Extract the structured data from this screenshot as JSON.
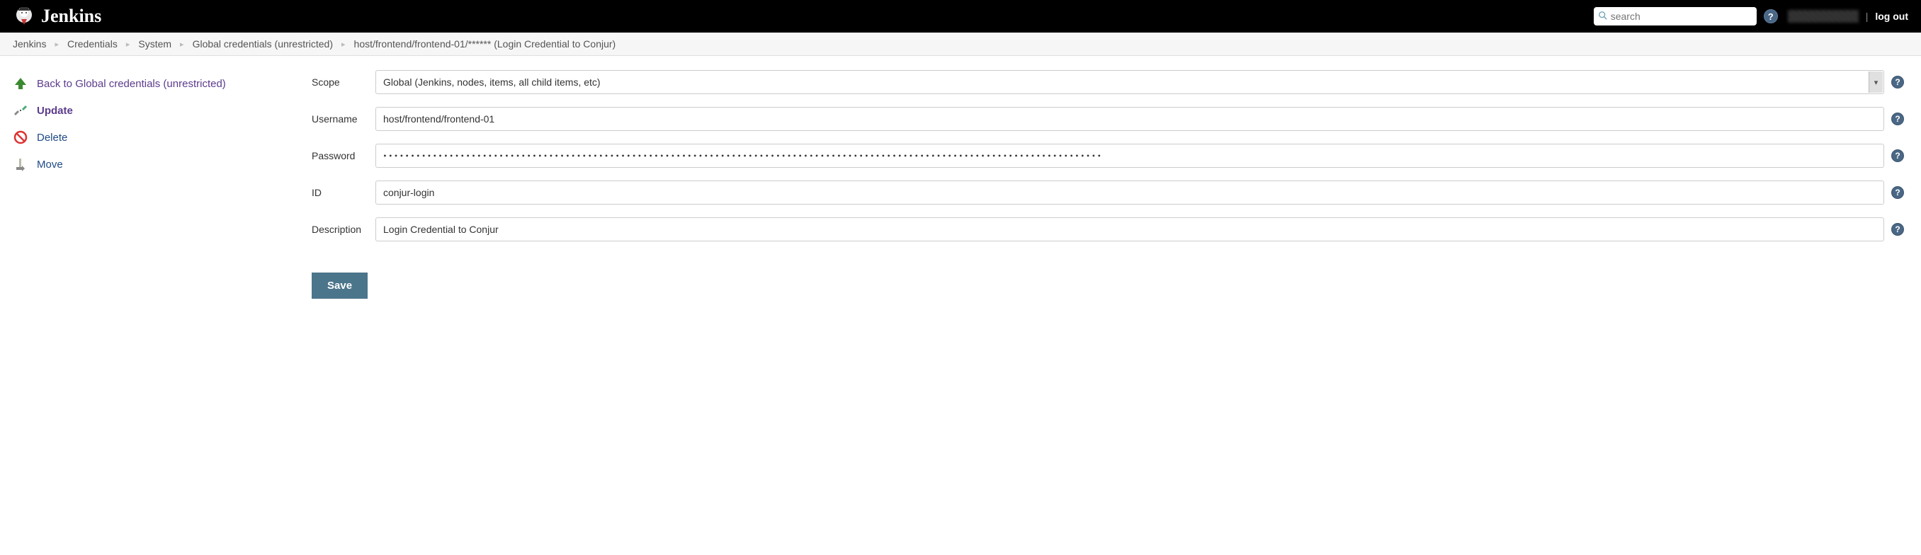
{
  "header": {
    "brand": "Jenkins",
    "search_placeholder": "search",
    "logout_label": "log out"
  },
  "breadcrumb": {
    "items": [
      "Jenkins",
      "Credentials",
      "System",
      "Global credentials (unrestricted)",
      "host/frontend/frontend-01/****** (Login Credential to Conjur)"
    ]
  },
  "sidebar": {
    "items": [
      {
        "label": "Back to Global credentials (unrestricted)",
        "icon": "arrow-up-icon",
        "style": "purple"
      },
      {
        "label": "Update",
        "icon": "tools-icon",
        "style": "purple-bold"
      },
      {
        "label": "Delete",
        "icon": "no-entry-icon",
        "style": "blue"
      },
      {
        "label": "Move",
        "icon": "move-icon",
        "style": "blue"
      }
    ]
  },
  "form": {
    "scope": {
      "label": "Scope",
      "value": "Global (Jenkins, nodes, items, all child items, etc)"
    },
    "username": {
      "label": "Username",
      "value": "host/frontend/frontend-01"
    },
    "password": {
      "label": "Password",
      "value": "••••••••••••••••••••••••••••••••••••••••••••••••••••••••••••••••••••••••••••••••••••••••••••••••••••••••••••••••••••••••••••••••••"
    },
    "id": {
      "label": "ID",
      "value": "conjur-login"
    },
    "description": {
      "label": "Description",
      "value": "Login Credential to Conjur"
    },
    "save_label": "Save"
  }
}
